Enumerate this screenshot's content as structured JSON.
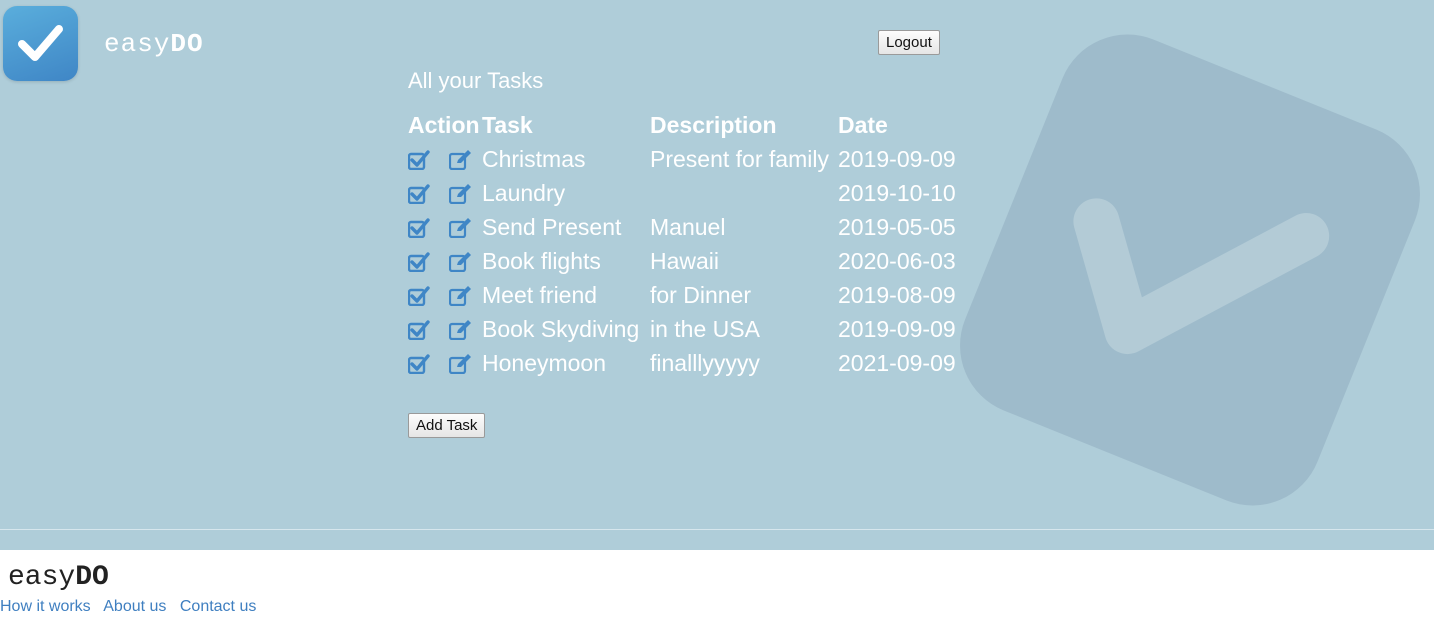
{
  "header": {
    "brand_light": "easy",
    "brand_bold": "DO",
    "logout_label": "Logout"
  },
  "main": {
    "title": "All your Tasks",
    "columns": {
      "action": "Action",
      "task": "Task",
      "description": "Description",
      "date": "Date"
    },
    "rows": [
      {
        "task": "Christmas",
        "description": "Present for family",
        "date": "2019-09-09"
      },
      {
        "task": "Laundry",
        "description": "",
        "date": "2019-10-10"
      },
      {
        "task": "Send Present",
        "description": "Manuel",
        "date": "2019-05-05"
      },
      {
        "task": "Book flights",
        "description": "Hawaii",
        "date": "2020-06-03"
      },
      {
        "task": "Meet friend",
        "description": "for Dinner",
        "date": "2019-08-09"
      },
      {
        "task": "Book Skydiving",
        "description": "in the USA",
        "date": "2019-09-09"
      },
      {
        "task": "Honeymoon",
        "description": "finalllyyyyy",
        "date": "2021-09-09"
      }
    ],
    "row_icons": [
      "check-square-icon",
      "edit-icon"
    ],
    "add_task_label": "Add Task"
  },
  "footer": {
    "brand_light": "easy",
    "brand_bold": "DO",
    "links": [
      "How it works",
      "About us",
      "Contact us"
    ]
  },
  "colors": {
    "hero_bg": "#afcdd9",
    "icon_blue": "#3f86c6",
    "link_blue": "#3f7fc0",
    "text_white": "#ffffff"
  }
}
